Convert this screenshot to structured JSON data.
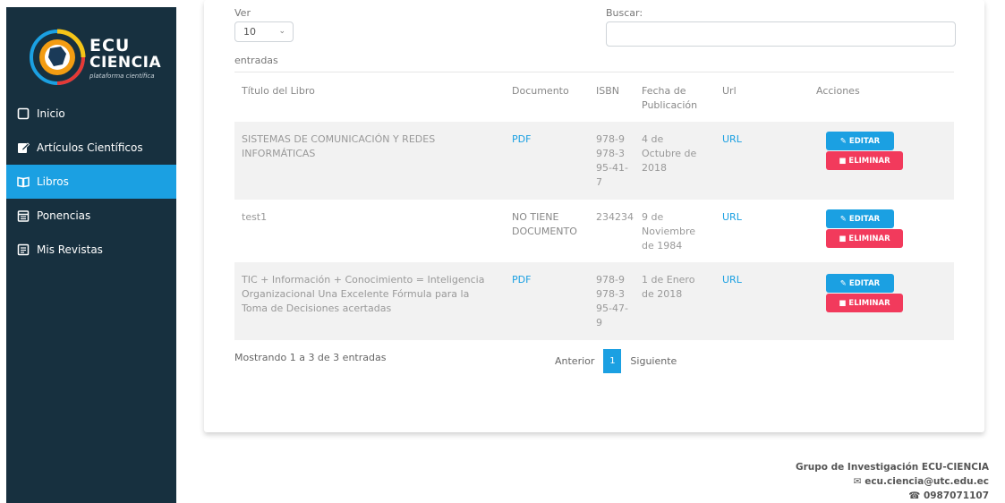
{
  "brand": {
    "line1": "ECU",
    "line2": "CIENCIA",
    "tagline": "plataforma científica"
  },
  "sidebar": {
    "items": [
      {
        "label": "Inicio",
        "icon": "square-icon"
      },
      {
        "label": "Artículos Científicos",
        "icon": "edit-icon"
      },
      {
        "label": "Libros",
        "icon": "book-icon",
        "active": true
      },
      {
        "label": "Ponencias",
        "icon": "calendar-icon"
      },
      {
        "label": "Mis Revistas",
        "icon": "journal-icon"
      }
    ]
  },
  "controls": {
    "show_label": "Ver",
    "page_size": "10",
    "entries_label": "entradas",
    "search_label": "Buscar:",
    "search_value": ""
  },
  "table": {
    "headers": [
      "Título del Libro",
      "Documento",
      "ISBN",
      "Fecha de Publicación",
      "Url",
      "Acciones"
    ],
    "rows": [
      {
        "title": "SISTEMAS DE COMUNICACIÓN Y REDES INFORMÁTICAS",
        "document": "PDF",
        "isbn": "978-9978-395-41-7",
        "date": "4 de Octubre de 2018",
        "url": "URL"
      },
      {
        "title": "test1",
        "document": "NO TIENE DOCUMENTO",
        "isbn": "234234",
        "date": "9 de Noviembre de 1984",
        "url": "URL"
      },
      {
        "title": "TIC + Información + Conocimiento = Inteligencia Organizacional Una Excelente Fórmula para la Toma de Decisiones acertadas",
        "document": "PDF",
        "isbn": "978-9978-395-47-9",
        "date": "1 de Enero de 2018",
        "url": "URL"
      }
    ],
    "edit_label": "EDITAR",
    "delete_label": "ELIMINAR"
  },
  "pagination": {
    "info": "Mostrando 1 a 3 de 3 entradas",
    "prev": "Anterior",
    "current": "1",
    "next": "Siguiente"
  },
  "footer": {
    "group": "Grupo de Investigación ECU-CIENCIA",
    "email": "ecu.ciencia@utc.edu.ec",
    "phone": "0987071107"
  },
  "colors": {
    "sidebar": "#17303f",
    "accent": "#1ba0e2",
    "danger": "#f23a5c",
    "row_alt": "#f2f2f2"
  }
}
